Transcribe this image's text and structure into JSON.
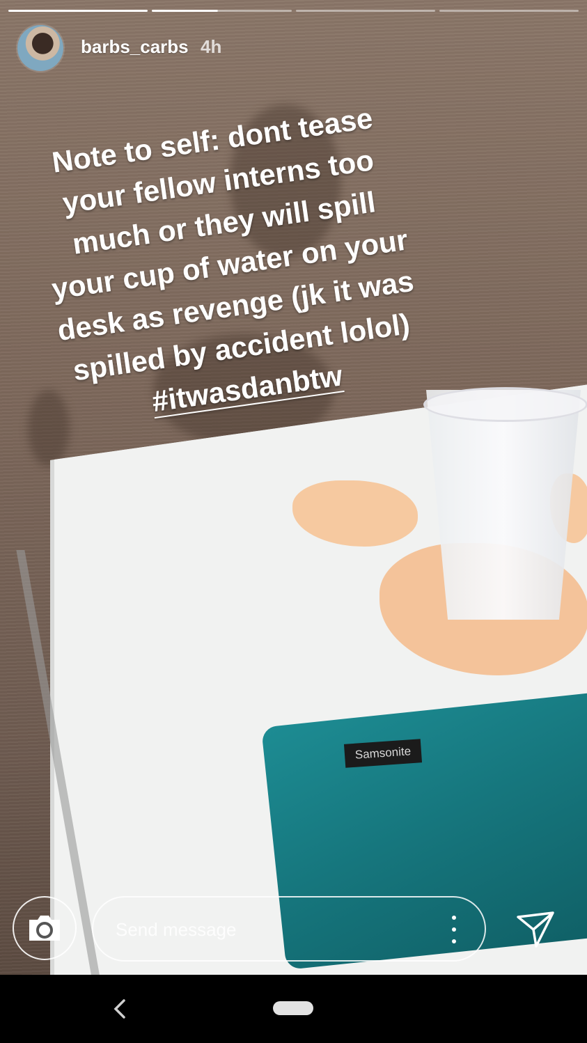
{
  "story": {
    "progress": [
      1,
      0.47,
      0,
      0
    ],
    "username": "barbs_carbs",
    "posted_ago": "4h",
    "caption_text": "Note to self: dont tease your fellow interns too much or they will spill your cup of water on your desk as revenge (jk it was spilled by accident lolol) ",
    "caption_hashtag": "#itwasdanbtw",
    "case_brand": "Samsonite"
  },
  "reply_bar": {
    "message_placeholder": "Send message",
    "camera_icon": "camera-icon",
    "more_icon": "more-vertical-icon",
    "send_icon": "send-icon"
  },
  "nav": {
    "back_icon": "back-chevron-icon",
    "home_icon": "home-pill-icon"
  }
}
